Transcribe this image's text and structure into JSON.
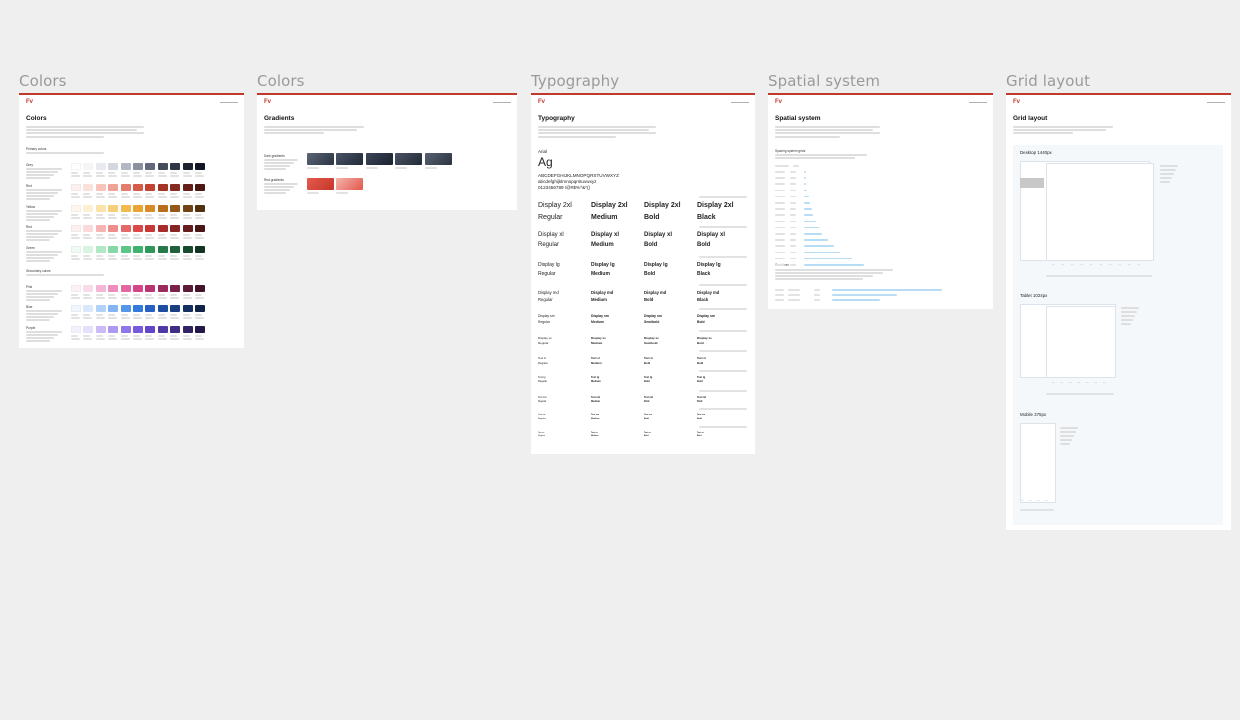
{
  "canvas": {
    "background": "#efefef",
    "accent": "#c0392b"
  },
  "frames": [
    {
      "id": "colors",
      "label": "Colors"
    },
    {
      "id": "gradients",
      "label": "Colors"
    },
    {
      "id": "typography",
      "label": "Typography"
    },
    {
      "id": "spatial",
      "label": "Spatial system"
    },
    {
      "id": "grid",
      "label": "Grid layout"
    }
  ],
  "boards": {
    "colors": {
      "logo": "Fv",
      "title": "Colors",
      "sections": [
        "Primary colors",
        "Secondary colors"
      ],
      "palettes": [
        {
          "name": "Grey",
          "colors": [
            "#ffffff",
            "#f4f5f7",
            "#e9eaef",
            "#d4d7de",
            "#b4b8c4",
            "#8a90a0",
            "#636a7c",
            "#454c5e",
            "#2f3546",
            "#1d2231",
            "#121624"
          ]
        },
        {
          "name": "Red",
          "colors": [
            "#fdf1ef",
            "#fbe1dc",
            "#f7c4bb",
            "#f0a296",
            "#e47d6d",
            "#d85a49",
            "#c24331",
            "#a33426",
            "#842a20",
            "#65201a",
            "#4a1713"
          ]
        },
        {
          "name": "Yellow",
          "colors": [
            "#fef8ec",
            "#fdf0d2",
            "#fbe2a8",
            "#f7cf7a",
            "#f2b94d",
            "#eba333",
            "#d98a22",
            "#b86e1b",
            "#955718",
            "#724315",
            "#523111"
          ]
        },
        {
          "name": "Red",
          "colors": [
            "#fdf0f0",
            "#fbdada",
            "#f6b4b4",
            "#ef8c8c",
            "#e66767",
            "#db4848",
            "#c83636",
            "#a82c2c",
            "#872525",
            "#671e1e",
            "#4a1616"
          ]
        },
        {
          "name": "Green",
          "colors": [
            "#effaf3",
            "#d9f3e2",
            "#b2e7c6",
            "#86d8a6",
            "#5cc686",
            "#3fb26d",
            "#2f975a",
            "#267a4a",
            "#1f613c",
            "#184a2f",
            "#113522"
          ]
        },
        {
          "name": "Pink",
          "colors": [
            "#fdf0f6",
            "#fadbea",
            "#f5b6d4",
            "#ed8dbb",
            "#e365a2",
            "#d44689",
            "#bb3372",
            "#9b2a5e",
            "#7b224b",
            "#5d1a39",
            "#431329"
          ]
        },
        {
          "name": "Blue",
          "colors": [
            "#eff6fe",
            "#d9e9fc",
            "#b1d2f8",
            "#82b5f2",
            "#5497ea",
            "#3479de",
            "#2660c4",
            "#1f4ea0",
            "#1a3f80",
            "#153161",
            "#0f2446"
          ]
        },
        {
          "name": "Purple",
          "colors": [
            "#f4f1fe",
            "#e5defc",
            "#cbbcf8",
            "#ad98f2",
            "#8f76ea",
            "#7659de",
            "#6245c8",
            "#5038a6",
            "#402d86",
            "#312366",
            "#231849"
          ]
        }
      ]
    },
    "gradients": {
      "logo": "Fv",
      "title": "Gradients",
      "groups": [
        {
          "name": "Dark gradients",
          "colors": [
            [
              "#5a6577",
              "#2c3442"
            ],
            [
              "#4a5467",
              "#222a37"
            ],
            [
              "#3c4658",
              "#1b2230"
            ],
            [
              "#4b5364",
              "#232a36"
            ],
            [
              "#596273",
              "#2c3340"
            ]
          ]
        },
        {
          "name": "Red gradients",
          "colors": [
            [
              "#e35a4c",
              "#c7362a"
            ],
            [
              "#f2b4ae",
              "#e4574b"
            ]
          ]
        }
      ]
    },
    "typography": {
      "logo": "Fv",
      "title": "Typography",
      "font_name": "Arial",
      "sample": "Ag",
      "uppercase": "ABCDEFGHIJKLMNOPQRSTUVWXYZ",
      "lowercase": "abcdefghijklmnopqrstuvwxyz",
      "digits": "0123456789 !@#$%^&*()",
      "styles": [
        {
          "name": "Display 2xl",
          "weights": [
            "Regular",
            "Medium",
            "Bold",
            "Black"
          ]
        },
        {
          "name": "Display xl",
          "weights": [
            "Regular",
            "Medium",
            "Bold",
            "Bold"
          ]
        },
        {
          "name": "Display lg",
          "weights": [
            "Regular",
            "Medium",
            "Bold",
            "Black"
          ]
        },
        {
          "name": "Display md",
          "weights": [
            "Regular",
            "Medium",
            "Bold",
            "Black"
          ]
        },
        {
          "name": "Display sm",
          "weights": [
            "Regular",
            "Medium",
            "Semibold",
            "Bold"
          ]
        },
        {
          "name": "Display xs",
          "weights": [
            "Regular",
            "Medium",
            "Semibold",
            "Bold"
          ]
        },
        {
          "name": "Text xl",
          "weights": [
            "Regular",
            "Medium",
            "Bold",
            "Bold"
          ]
        },
        {
          "name": "Text lg",
          "weights": [
            "Regular",
            "Medium",
            "Bold",
            "Bold"
          ]
        },
        {
          "name": "Text md",
          "weights": [
            "Regular",
            "Medium",
            "Bold",
            "Bold"
          ]
        },
        {
          "name": "Text sm",
          "weights": [
            "Regular",
            "Medium",
            "Bold",
            "Bold"
          ]
        },
        {
          "name": "Text xs",
          "weights": [
            "Regular",
            "Medium",
            "Bold",
            "Bold"
          ]
        }
      ]
    },
    "spatial": {
      "logo": "Fv",
      "title": "Spatial system",
      "sections": [
        "Spacing system grids",
        "Container"
      ],
      "spacing_scale": [
        0.5,
        1,
        1.5,
        2,
        3,
        4,
        5,
        6,
        8,
        10,
        12,
        16,
        20,
        24,
        32,
        40
      ]
    },
    "grid": {
      "logo": "Fv",
      "title": "Grid layout",
      "breakpoints": [
        {
          "name": "Desktop 1440px"
        },
        {
          "name": "Tablet 1024px"
        },
        {
          "name": "Mobile 375px"
        }
      ]
    }
  }
}
